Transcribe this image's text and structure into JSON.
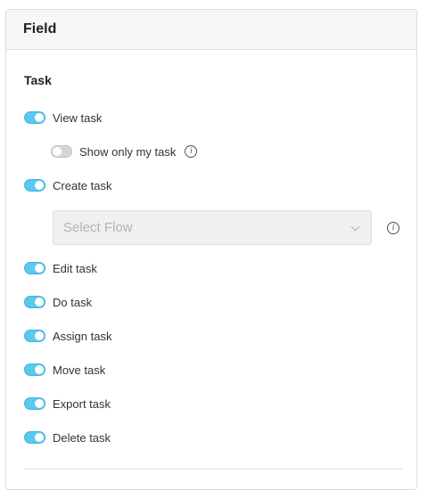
{
  "panel": {
    "title": "Field"
  },
  "section": {
    "title": "Task"
  },
  "permissions": [
    {
      "label": "View task",
      "enabled": true
    },
    {
      "label": "Show only my task",
      "enabled": false
    },
    {
      "label": "Create task",
      "enabled": true
    },
    {
      "label": "Edit task",
      "enabled": true
    },
    {
      "label": "Do task",
      "enabled": true
    },
    {
      "label": "Assign task",
      "enabled": true
    },
    {
      "label": "Move task",
      "enabled": true
    },
    {
      "label": "Export task",
      "enabled": true
    },
    {
      "label": "Delete task",
      "enabled": true
    }
  ],
  "flow_select": {
    "placeholder": "Select Flow",
    "value": ""
  },
  "icons": {
    "info": "info-icon",
    "chevron": "chevron-down-icon"
  },
  "colors": {
    "toggle_on": "#5bc8ee",
    "toggle_off": "#d6d6d6",
    "header_bg": "#f7f7f7"
  }
}
